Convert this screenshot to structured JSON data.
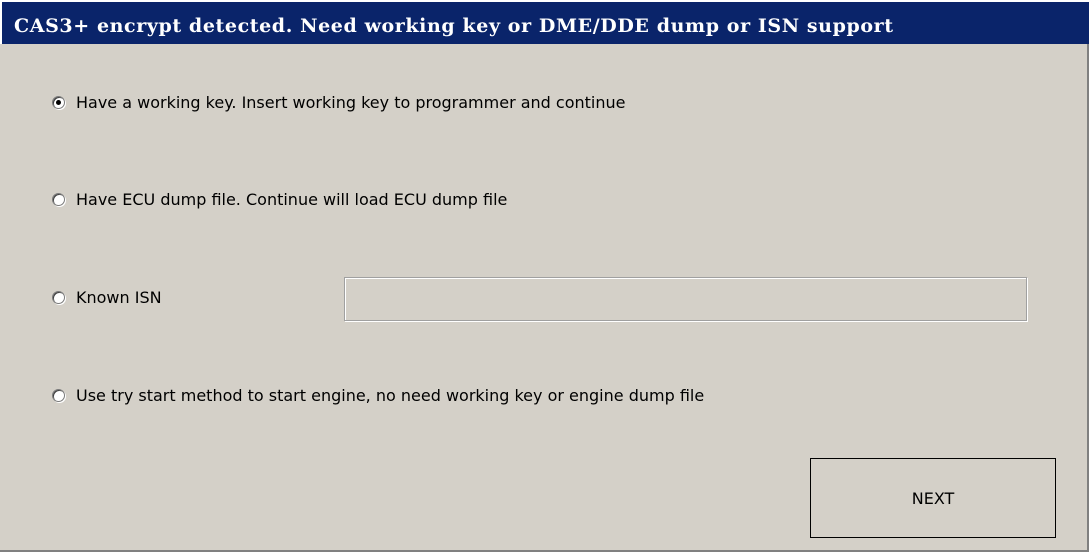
{
  "window": {
    "title": "CAS3+ encrypt detected. Need working key or DME/DDE dump or ISN support"
  },
  "options": [
    {
      "label": "Have a working key. Insert working key to programmer and continue",
      "selected": true
    },
    {
      "label": "Have ECU dump file. Continue will load ECU dump file",
      "selected": false
    },
    {
      "label": "Known ISN",
      "selected": false
    },
    {
      "label": "Use try start method to start engine, no need working key or engine dump file",
      "selected": false
    }
  ],
  "isn_input": {
    "value": "",
    "placeholder": ""
  },
  "buttons": {
    "next_label": "NEXT"
  },
  "colors": {
    "titlebar": "#0a246a",
    "window_background": "#d4d0c8"
  }
}
